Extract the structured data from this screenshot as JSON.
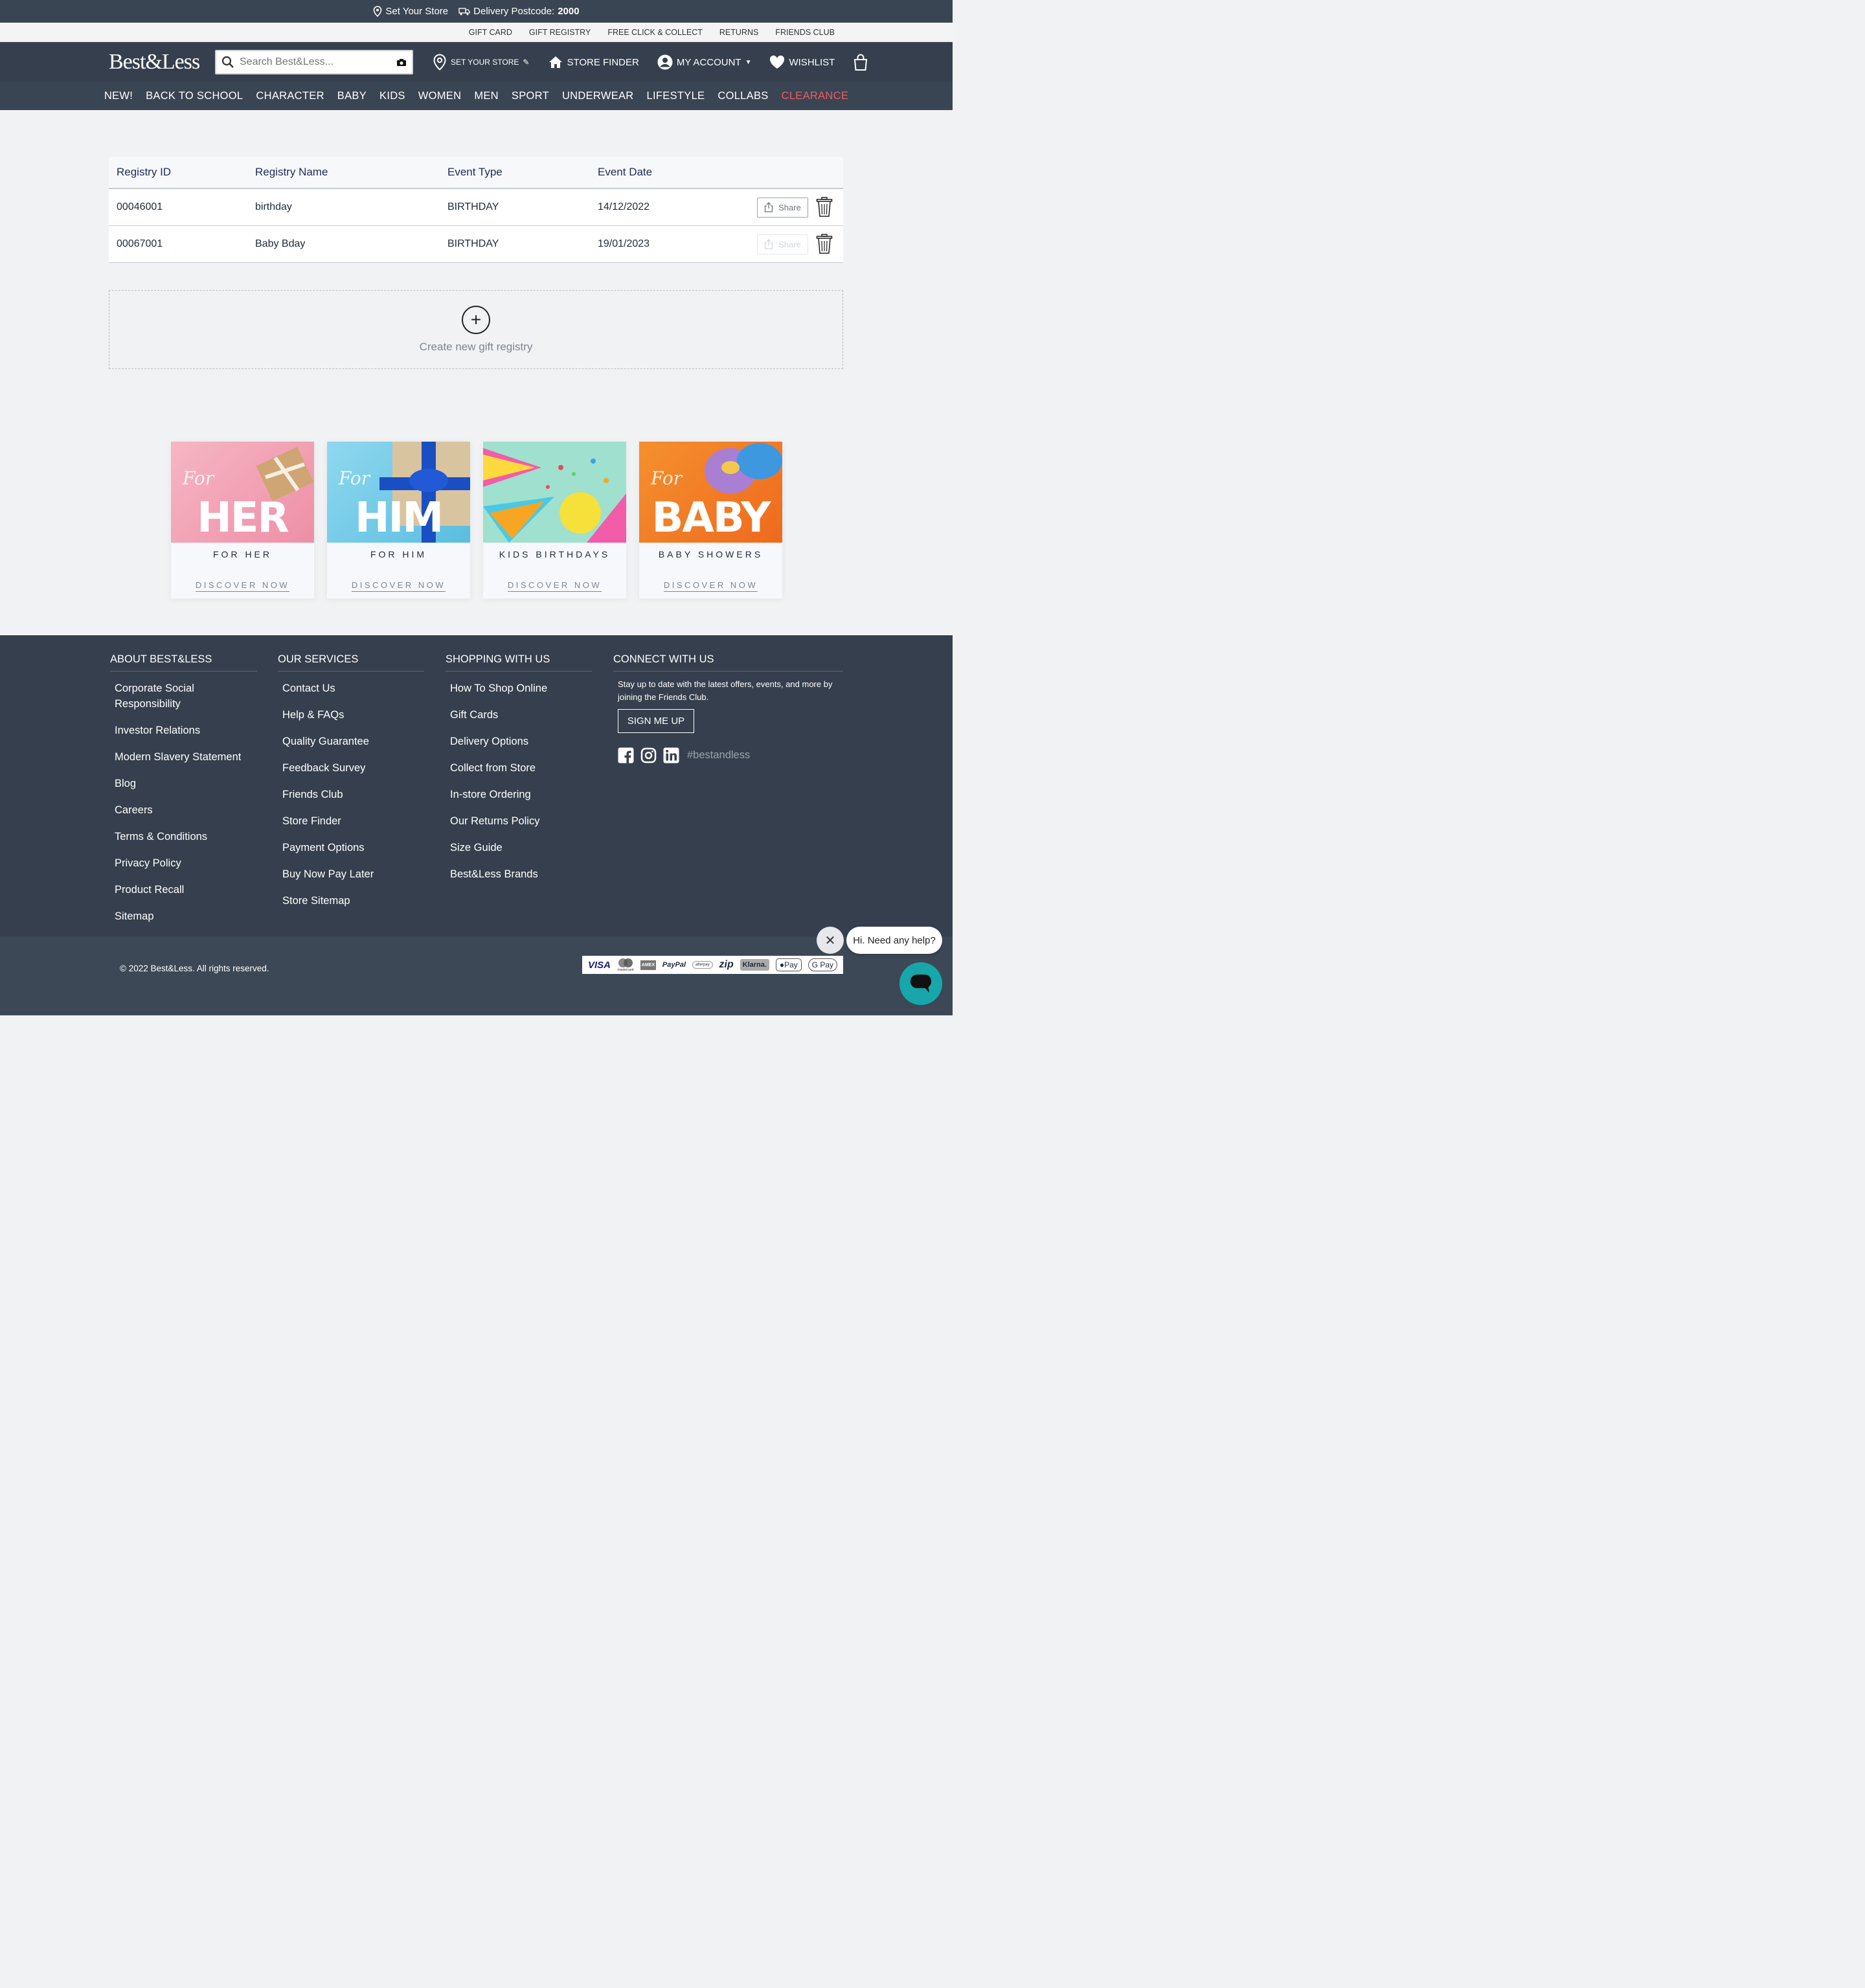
{
  "topbar": {
    "store": "Set Your Store",
    "postcode_label": "Delivery Postcode:",
    "postcode": "2000"
  },
  "utility_links": [
    "GIFT CARD",
    "GIFT REGISTRY",
    "FREE CLICK & COLLECT",
    "RETURNS",
    "FRIENDS CLUB"
  ],
  "header": {
    "logo": "Best&Less",
    "search_placeholder": "Search Best&Less...",
    "set_store": "SET YOUR STORE",
    "store_finder": "STORE FINDER",
    "my_account": "MY ACCOUNT",
    "wishlist": "WISHLIST"
  },
  "nav": [
    "NEW!",
    "BACK TO SCHOOL",
    "CHARACTER",
    "BABY",
    "KIDS",
    "WOMEN",
    "MEN",
    "SPORT",
    "UNDERWEAR",
    "LIFESTYLE",
    "COLLABS",
    "CLEARANCE"
  ],
  "registry": {
    "columns": [
      "Registry ID",
      "Registry Name",
      "Event Type",
      "Event Date"
    ],
    "rows": [
      {
        "id": "00046001",
        "name": "birthday",
        "type": "BIRTHDAY",
        "date": "14/12/2022",
        "share": "Share",
        "share_enabled": true
      },
      {
        "id": "00067001",
        "name": "Baby Bday",
        "type": "BIRTHDAY",
        "date": "19/01/2023",
        "share": "Share",
        "share_enabled": false
      }
    ],
    "create_label": "Create new gift registry"
  },
  "cards": [
    {
      "script": "For",
      "big": "HER",
      "title": "FOR HER",
      "link": "DISCOVER NOW",
      "bg": "#f3a7b8"
    },
    {
      "script": "For",
      "big": "HIM",
      "title": "FOR HIM",
      "link": "DISCOVER NOW",
      "bg": "#7fcfe8"
    },
    {
      "script": "",
      "big": "",
      "title": "KIDS BIRTHDAYS",
      "link": "DISCOVER NOW",
      "bg": "#9fe0cf"
    },
    {
      "script": "For",
      "big": "BABY",
      "title": "BABY SHOWERS",
      "link": "DISCOVER NOW",
      "bg": "#f07a2a"
    }
  ],
  "footer": {
    "about": {
      "title": "ABOUT BEST&LESS",
      "links": [
        "Corporate Social Responsibility",
        "Investor Relations",
        "Modern Slavery Statement",
        "Blog",
        "Careers",
        "Terms & Conditions",
        "Privacy Policy",
        "Product Recall",
        "Sitemap"
      ]
    },
    "services": {
      "title": "OUR SERVICES",
      "links": [
        "Contact Us",
        "Help & FAQs",
        "Quality Guarantee",
        "Feedback Survey",
        "Friends Club",
        "Store Finder",
        "Payment Options",
        "Buy Now Pay Later",
        "Store Sitemap"
      ]
    },
    "shopping": {
      "title": "SHOPPING WITH US",
      "links": [
        "How To Shop Online",
        "Gift Cards",
        "Delivery Options",
        "Collect from Store",
        "In-store Ordering",
        "Our Returns Policy",
        "Size Guide",
        "Best&Less Brands"
      ]
    },
    "connect": {
      "title": "CONNECT WITH US",
      "text": "Stay up to date with the latest offers, events, and more by joining the Friends Club.",
      "button": "SIGN ME UP",
      "hashtag": "#bestandless"
    }
  },
  "bottom": {
    "copyright": "© 2022 Best&Less. All rights reserved.",
    "payments": [
      "VISA",
      "mastercard",
      "AMEX",
      "PayPal",
      "afterpay",
      "zip",
      "Klarna.",
      "Pay",
      "G Pay"
    ]
  },
  "chat": {
    "greeting": "Hi. Need any help?"
  },
  "colors": {
    "header": "#353f4d",
    "clearance": "#f05a5a",
    "chat": "#17a6a9"
  }
}
